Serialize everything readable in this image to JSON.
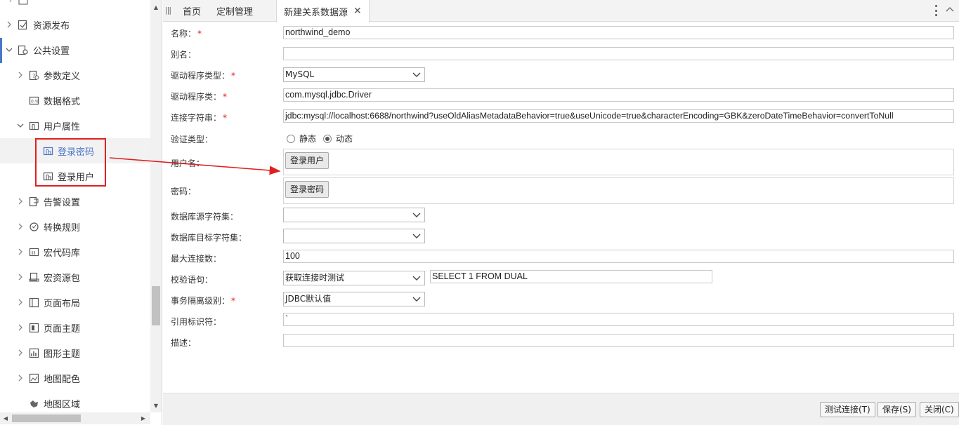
{
  "sidebar": {
    "items": [
      {
        "label": "资源发布",
        "icon": "publish-icon",
        "chevron": "right"
      },
      {
        "label": "公共设置",
        "icon": "settings-folder-icon",
        "chevron": "down"
      },
      {
        "label": "参数定义",
        "icon": "parameter-icon",
        "chevron": "right"
      },
      {
        "label": "数据格式",
        "icon": "data-format-icon",
        "chevron": ""
      },
      {
        "label": "用户属性",
        "icon": "user-attribute-icon",
        "chevron": "down"
      },
      {
        "label": "登录密码",
        "icon": "hand-pointer-icon",
        "chevron": ""
      },
      {
        "label": "登录用户",
        "icon": "hand-pointer-icon",
        "chevron": ""
      },
      {
        "label": "告警设置",
        "icon": "alarm-icon",
        "chevron": "right"
      },
      {
        "label": "转换规则",
        "icon": "convert-rule-icon",
        "chevron": "right"
      },
      {
        "label": "宏代码库",
        "icon": "macro-code-icon",
        "chevron": "right"
      },
      {
        "label": "宏资源包",
        "icon": "macro-package-icon",
        "chevron": "right"
      },
      {
        "label": "页面布局",
        "icon": "page-layout-icon",
        "chevron": "right"
      },
      {
        "label": "页面主题",
        "icon": "page-theme-icon",
        "chevron": "right"
      },
      {
        "label": "图形主题",
        "icon": "chart-theme-icon",
        "chevron": "right"
      },
      {
        "label": "地图配色",
        "icon": "map-color-icon",
        "chevron": "right"
      },
      {
        "label": "地图区域",
        "icon": "map-area-icon",
        "chevron": ""
      }
    ]
  },
  "tabs": {
    "home": "首页",
    "custom": "定制管理",
    "new_datasource": "新建关系数据源",
    "close_glyph": "✕"
  },
  "form": {
    "name": {
      "label": "名称：",
      "value": "northwind_demo"
    },
    "alias": {
      "label": "别名：",
      "value": ""
    },
    "driver_type": {
      "label": "驱动程序类型：",
      "value": "MySQL"
    },
    "driver_class": {
      "label": "驱动程序类：",
      "value": "com.mysql.jdbc.Driver"
    },
    "connection_string": {
      "label": "连接字符串：",
      "value": "jdbc:mysql://localhost:6688/northwind?useOldAliasMetadataBehavior=true&useUnicode=true&characterEncoding=GBK&zeroDateTimeBehavior=convertToNull"
    },
    "auth_type": {
      "label": "验证类型：",
      "static": "静态",
      "dynamic": "动态",
      "selected": "动态"
    },
    "username": {
      "label": "用户名：",
      "button": "登录用户"
    },
    "password": {
      "label": "密码：",
      "button": "登录密码"
    },
    "db_source_charset": {
      "label": "数据库源字符集：",
      "value": ""
    },
    "db_target_charset": {
      "label": "数据库目标字符集：",
      "value": ""
    },
    "max_connections": {
      "label": "最大连接数：",
      "value": "100"
    },
    "validation": {
      "label": "校验语句：",
      "mode": "获取连接时测试",
      "sql": "SELECT 1 FROM DUAL"
    },
    "isolation": {
      "label": "事务隔离级别：",
      "value": "JDBC默认值"
    },
    "quote": {
      "label": "引用标识符：",
      "value": "`"
    },
    "description": {
      "label": "描述：",
      "value": ""
    },
    "required_mark": "*"
  },
  "footer": {
    "test": "测试连接(T)",
    "save": "保存(S)",
    "close": "关闭(C)"
  },
  "colors": {
    "accent": "#4a76c8",
    "required": "#e02020",
    "annotation": "#e02020"
  }
}
